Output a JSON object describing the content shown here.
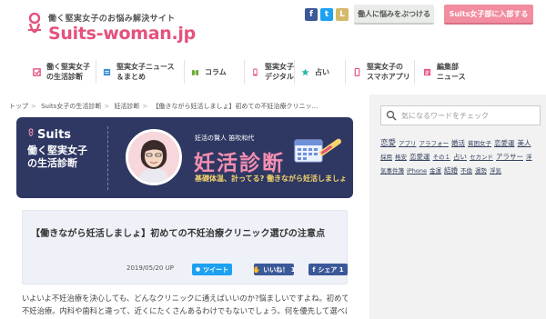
{
  "header": {
    "tagline": "働く堅実女子のお悩み解決サイト",
    "logo_text": "Suits-woman.jp",
    "consult_button": "働人に悩みをぶつける",
    "join_button": "Suits女子部に入部する",
    "social": [
      {
        "name": "facebook",
        "glyph": "f"
      },
      {
        "name": "twitter",
        "glyph": "t"
      },
      {
        "name": "line",
        "glyph": "L"
      }
    ]
  },
  "nav": [
    {
      "label1": "働く堅実女子",
      "label2": "の生活診断",
      "icon_color": "#e4527c"
    },
    {
      "label1": "堅実女子ニュース",
      "label2": "＆まとめ",
      "icon_color": "#3a8fd6"
    },
    {
      "label1": "コラム",
      "label2": "",
      "icon_color": "#6cab3a"
    },
    {
      "label1": "堅実女子",
      "label2": "デジタル",
      "icon_color": "#e4527c"
    },
    {
      "label1": "占い",
      "label2": "",
      "icon_color": "#2bb7a7"
    },
    {
      "label1": "堅実女子の",
      "label2": "スマホアプリ",
      "icon_color": "#e4527c"
    },
    {
      "label1": "編集部",
      "label2": "ニュース",
      "icon_color": "#e4527c"
    }
  ],
  "breadcrumb": [
    "トップ",
    "Suits女子の生活診断",
    "妊活診断",
    "【働きながら妊活しましょ】初めての不妊治療クリニッ..."
  ],
  "banner": {
    "brand": "Suits",
    "sub_line1": "働く堅実女子",
    "sub_line2": "の生活診断",
    "caption": "妊活の賢人 笛吹和代",
    "title": "妊活診断",
    "subtitle": "基礎体温、計ってる? 働きながら妊活しましょ"
  },
  "article": {
    "title": "【働きながら妊活しましょ】初めての不妊治療クリニック選びの注意点",
    "date": "2019/05/20 UP",
    "tweet_label": "ツイート",
    "like_label": "いいね！ 1",
    "share_label": "シェア 1",
    "body": [
      "いよいよ不妊治療を決心しても、どんなクリニックに通えばいいのか?悩ましいですよね。初めての",
      "不妊治療。内科や歯科と違って、近くにたくさんあるわけでもないでしょう。何を優先して選べばいい"
    ]
  },
  "sidebar": {
    "search_placeholder": "気になるワードをチェック",
    "tags": [
      {
        "text": "恋愛",
        "size": "l"
      },
      {
        "text": "アプリ",
        "size": "s"
      },
      {
        "text": "アラフォー",
        "size": "s"
      },
      {
        "text": "婚活",
        "size": "m"
      },
      {
        "text": "貧困女子",
        "size": "s"
      },
      {
        "text": "恋愛運",
        "size": "m"
      },
      {
        "text": "美人",
        "size": "m"
      },
      {
        "text": "採用",
        "size": "s"
      },
      {
        "text": "格安",
        "size": "s"
      },
      {
        "text": "恋愛運",
        "size": "m"
      },
      {
        "text": "その１",
        "size": "s"
      },
      {
        "text": "占い",
        "size": "m"
      },
      {
        "text": "セカンド",
        "size": "s"
      },
      {
        "text": "アラサー",
        "size": "m"
      },
      {
        "text": "浮",
        "size": "s"
      },
      {
        "text": "気事件簿",
        "size": "s"
      },
      {
        "text": "iPhone",
        "size": "s"
      },
      {
        "text": "金運",
        "size": "s"
      },
      {
        "text": "結婚",
        "size": "m"
      },
      {
        "text": "不倫",
        "size": "s"
      },
      {
        "text": "運勢",
        "size": "s"
      },
      {
        "text": "浮気",
        "size": "s"
      }
    ]
  }
}
